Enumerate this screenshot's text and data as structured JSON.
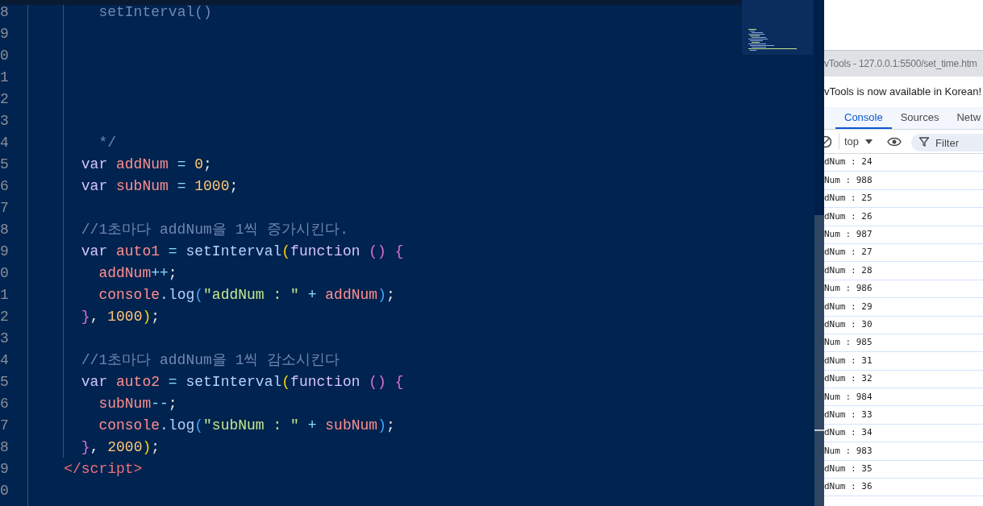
{
  "editor": {
    "lines": [
      {
        "number": "8",
        "tokens": [
          {
            "kind": "comment",
            "text": "        setInterval()"
          }
        ]
      },
      {
        "number": "9"
      },
      {
        "number": "0"
      },
      {
        "number": "1"
      },
      {
        "number": "2"
      },
      {
        "number": "3"
      },
      {
        "number": "4",
        "tokens": [
          {
            "kind": "comment",
            "text": "        */"
          }
        ]
      },
      {
        "number": "5",
        "tokens": [
          {
            "kind": "keyword",
            "text": "      var"
          },
          {
            "kind": "variable",
            "text": " addNum"
          },
          {
            "kind": "operator",
            "text": " ="
          },
          {
            "kind": "number",
            "text": " 0"
          },
          {
            "kind": "punct",
            "text": ";"
          }
        ]
      },
      {
        "number": "6",
        "tokens": [
          {
            "kind": "keyword",
            "text": "      var"
          },
          {
            "kind": "variable",
            "text": " subNum"
          },
          {
            "kind": "operator",
            "text": " ="
          },
          {
            "kind": "number",
            "text": " 1000"
          },
          {
            "kind": "punct",
            "text": ";"
          }
        ]
      },
      {
        "number": "7"
      },
      {
        "number": "8",
        "tokens": [
          {
            "kind": "comment",
            "text": "      //1초마다 addNum을 1씩 증가시킨다."
          }
        ]
      },
      {
        "number": "9",
        "tokens": [
          {
            "kind": "keyword",
            "text": "      var"
          },
          {
            "kind": "variable",
            "text": " auto1"
          },
          {
            "kind": "operator",
            "text": " ="
          },
          {
            "kind": "function",
            "text": " setInterval"
          },
          {
            "kind": "bracket1",
            "text": "("
          },
          {
            "kind": "keyword",
            "text": "function"
          },
          {
            "kind": "bracket2",
            "text": " ()"
          },
          {
            "kind": "bracket2",
            "text": " {"
          }
        ]
      },
      {
        "number": "0",
        "tokens": [
          {
            "kind": "variable",
            "text": "        addNum"
          },
          {
            "kind": "operator",
            "text": "++"
          },
          {
            "kind": "punct",
            "text": ";"
          }
        ]
      },
      {
        "number": "1",
        "tokens": [
          {
            "kind": "variable",
            "text": "        console"
          },
          {
            "kind": "function",
            "text": ".log"
          },
          {
            "kind": "bracket3",
            "text": "("
          },
          {
            "kind": "string",
            "text": "\"addNum : \""
          },
          {
            "kind": "operator",
            "text": " +"
          },
          {
            "kind": "variable",
            "text": " addNum"
          },
          {
            "kind": "bracket3",
            "text": ")"
          },
          {
            "kind": "punct",
            "text": ";"
          }
        ]
      },
      {
        "number": "2",
        "tokens": [
          {
            "kind": "bracket2",
            "text": "      }"
          },
          {
            "kind": "punct",
            "text": ","
          },
          {
            "kind": "number",
            "text": " 1000"
          },
          {
            "kind": "bracket1",
            "text": ")"
          },
          {
            "kind": "punct",
            "text": ";"
          }
        ]
      },
      {
        "number": "3"
      },
      {
        "number": "4",
        "tokens": [
          {
            "kind": "comment",
            "text": "      //1초마다 addNum을 1씩 감소시킨다"
          }
        ]
      },
      {
        "number": "5",
        "tokens": [
          {
            "kind": "keyword",
            "text": "      var"
          },
          {
            "kind": "variable",
            "text": " auto2"
          },
          {
            "kind": "operator",
            "text": " ="
          },
          {
            "kind": "function",
            "text": " setInterval"
          },
          {
            "kind": "bracket1",
            "text": "("
          },
          {
            "kind": "keyword",
            "text": "function"
          },
          {
            "kind": "bracket2",
            "text": " ()"
          },
          {
            "kind": "bracket2",
            "text": " {"
          }
        ]
      },
      {
        "number": "6",
        "tokens": [
          {
            "kind": "variable",
            "text": "        subNum"
          },
          {
            "kind": "operator",
            "text": "--"
          },
          {
            "kind": "punct",
            "text": ";"
          }
        ]
      },
      {
        "number": "7",
        "tokens": [
          {
            "kind": "variable",
            "text": "        console"
          },
          {
            "kind": "function",
            "text": ".log"
          },
          {
            "kind": "bracket3",
            "text": "("
          },
          {
            "kind": "string",
            "text": "\"subNum : \""
          },
          {
            "kind": "operator",
            "text": " +"
          },
          {
            "kind": "variable",
            "text": " subNum"
          },
          {
            "kind": "bracket3",
            "text": ")"
          },
          {
            "kind": "punct",
            "text": ";"
          }
        ]
      },
      {
        "number": "8",
        "tokens": [
          {
            "kind": "bracket2",
            "text": "      }"
          },
          {
            "kind": "punct",
            "text": ","
          },
          {
            "kind": "number",
            "text": " 2000"
          },
          {
            "kind": "bracket1",
            "text": ")"
          },
          {
            "kind": "punct",
            "text": ";"
          }
        ]
      },
      {
        "number": "9",
        "tokens": [
          {
            "kind": "tag",
            "text": "    </script>"
          }
        ]
      },
      {
        "number": "0"
      }
    ]
  },
  "devtools": {
    "title": "vTools - 127.0.0.1:5500/set_time.htm",
    "notice": "vTools is now available in Korean!",
    "tabs": [
      {
        "label": "Console",
        "selected": true
      },
      {
        "label": "Sources",
        "selected": false
      },
      {
        "label": "Netw",
        "selected": false
      }
    ],
    "context": "top",
    "filter_placeholder": "Filter",
    "console_rows": [
      "dNum : 24",
      "Num : 988",
      "dNum : 25",
      "dNum : 26",
      "Num : 987",
      "dNum : 27",
      "dNum : 28",
      "Num : 986",
      "dNum : 29",
      "dNum : 30",
      "Num : 985",
      "dNum : 31",
      "dNum : 32",
      "Num : 984",
      "dNum : 33",
      "dNum : 34",
      "Num : 983",
      "dNum : 35",
      "dNum : 36"
    ]
  }
}
